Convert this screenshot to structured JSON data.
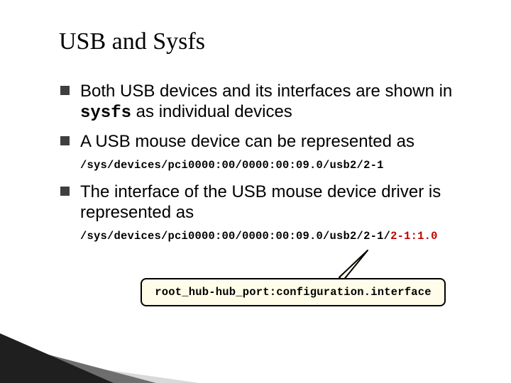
{
  "title": "USB and Sysfs",
  "bullets": {
    "b1_a": "Both USB devices and its interfaces are shown in ",
    "b1_code": "sysfs",
    "b1_b": " as individual devices",
    "b2": "A USB mouse device can be represented as",
    "path1": "/sys/devices/pci0000:00/0000:00:09.0/usb2/2-1",
    "b3": "The interface of the USB mouse device driver is represented as",
    "path2_a": "/sys/devices/pci0000:00/0000:00:09.0/usb2/2-1/",
    "path2_b": "2-1:1.0"
  },
  "callout": "root_hub-hub_port:configuration.interface"
}
